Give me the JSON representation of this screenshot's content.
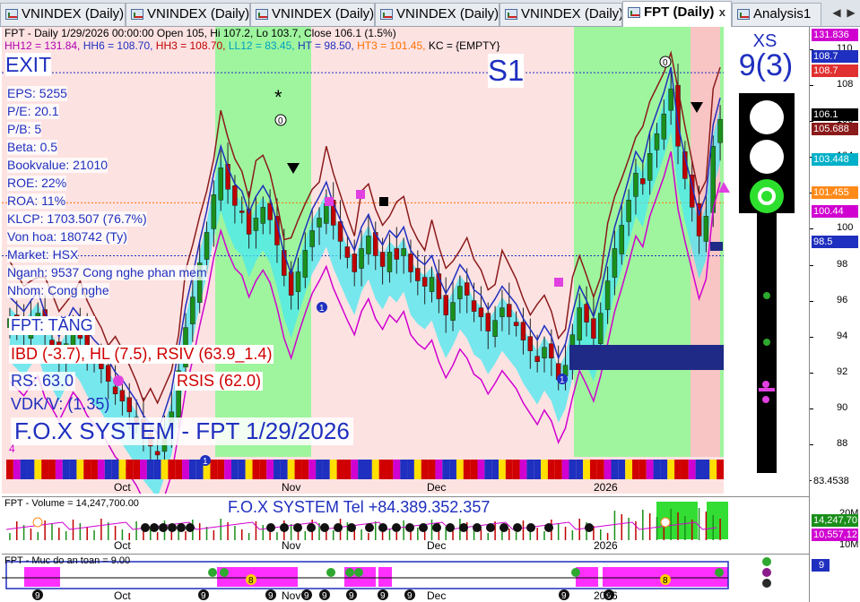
{
  "tabs": [
    {
      "label": "VNINDEX (Daily)",
      "active": false
    },
    {
      "label": "VNINDEX (Daily)",
      "active": false
    },
    {
      "label": "VNINDEX (Daily)",
      "active": false
    },
    {
      "label": "VNINDEX (Daily)",
      "active": false
    },
    {
      "label": "VNINDEX (Daily)",
      "active": false
    },
    {
      "label": "FPT (Daily)",
      "active": true
    },
    {
      "label": "Analysis1",
      "active": false
    }
  ],
  "tab_close": "x",
  "nav": {
    "left": "◀",
    "right": "▶"
  },
  "header": {
    "line1": "FPT - Daily 1/29/2026 00:00:00 Open 105, Hi 107.2, Lo 103.7, Close 106.1 (1.5%)",
    "line2": [
      {
        "text": "HH12 = 131.84, ",
        "color": "#b000b0"
      },
      {
        "text": "HH6 = 108.70, ",
        "color": "#1f2fbf"
      },
      {
        "text": "HH3 = 108.70, ",
        "color": "#c00000"
      },
      {
        "text": "LL12 = 83.45, ",
        "color": "#00a0c0"
      },
      {
        "text": "HT = 98.50, ",
        "color": "#1f2fbf"
      },
      {
        "text": "HT3 = 101.45, ",
        "color": "#ff7000"
      },
      {
        "text": "KC = {EMPTY}",
        "color": "#000"
      }
    ]
  },
  "overlay": {
    "exit": "EXIT",
    "s1": "S1",
    "xs": "XS",
    "xs_count": "9(3)",
    "fundamentals": [
      "EPS: 5255",
      "P/E: 20.1",
      "P/B: 5",
      "Beta: 0.5",
      "Bookvalue: 21010",
      "ROE: 22%",
      "ROA: 11%",
      "KLCP: 1703.507 (76.7%)",
      "Von hoa: 180742 (Ty)",
      "Market: HSX",
      "Nganh: 9537 Cong nghe phan mem",
      "Nhom: Cong nghe"
    ],
    "trend": "FPT: TĂNG",
    "ibd": "IBD (-3.7), HL (7.5), RSIV (63.9_1.4)",
    "rs": "RS: 63.0",
    "rsis": "RSIS (62.0)",
    "vdk": "VDK/V:  (1.35)",
    "system": "F.O.X SYSTEM - FPT 1/29/2026",
    "four": "4",
    "asterisk": "*"
  },
  "volume": {
    "label": "FPT - Volume = 14,247,700.00",
    "tel": "F.O.X SYSTEM Tel +84.389.352.357"
  },
  "safety": {
    "label": "FPT - Muc do an toan = 9.00"
  },
  "x_axis": [
    "Oct",
    "Nov",
    "Dec",
    "2026"
  ],
  "price_axis": {
    "ticks": [
      "110",
      "108",
      "106",
      "104",
      "102",
      "100",
      "98",
      "96",
      "94",
      "92",
      "90",
      "88",
      "86"
    ],
    "tags": [
      {
        "text": "131.836",
        "color": "#d000d0"
      },
      {
        "text": "108.7",
        "color": "#1f2fbf"
      },
      {
        "text": "108.7",
        "color": "#e03030"
      },
      {
        "text": "106.1",
        "color": "#000000"
      },
      {
        "text": "105.688",
        "color": "#8b1a1a"
      },
      {
        "text": "103.448",
        "color": "#00b0c8"
      },
      {
        "text": "101.455",
        "color": "#ff8a1a"
      },
      {
        "text": "100.44",
        "color": "#d000d0"
      },
      {
        "text": "98.5",
        "color": "#1f2fbf"
      },
      {
        "text": "83.4538",
        "color": "#00b0c8"
      }
    ],
    "vol_ticks": [
      "20M",
      "10M"
    ],
    "vol_tags": [
      {
        "text": "14,247,70",
        "color": "#1a8f1a"
      },
      {
        "text": "10,557,12",
        "color": "#d000d0"
      }
    ],
    "safety_tag": "9"
  },
  "markers": {
    "one": "1",
    "zero": "0",
    "eight": "8",
    "nine": "9"
  },
  "chart_data": {
    "type": "candlestick",
    "title": "FPT - Daily 1/29/2026",
    "last": {
      "open": 105,
      "high": 107.2,
      "low": 103.7,
      "close": 106.1,
      "change_pct": 1.5
    },
    "ylim": [
      85,
      111
    ],
    "levels": {
      "HH12": 131.84,
      "HH6": 108.7,
      "HH3": 108.7,
      "LL12": 83.45,
      "HT": 98.5,
      "HT3": 101.45
    },
    "closes": [
      95,
      94.6,
      94.2,
      94.8,
      95.3,
      94.1,
      93.5,
      92.8,
      93.6,
      94.4,
      93.9,
      93.1,
      92.6,
      92.2,
      91.5,
      90.8,
      90.4,
      89.8,
      89.2,
      88.4,
      87.9,
      87.4,
      88.6,
      89.8,
      92.1,
      94.5,
      96.2,
      98.1,
      99.8,
      101.9,
      103.4,
      102.2,
      101.3,
      100.9,
      99.7,
      100.6,
      101.2,
      100.5,
      99.1,
      97.4,
      96.3,
      97.6,
      98.8,
      99.9,
      100.6,
      101.4,
      100.2,
      99.3,
      98.4,
      97.6,
      98.9,
      99.6,
      98.5,
      97.9,
      98.7,
      98.3,
      98.9,
      97.6,
      97.1,
      96.8,
      97.3,
      96.1,
      95.2,
      95.9,
      96.8,
      96.3,
      95.4,
      95.1,
      94.3,
      94.9,
      95.6,
      95.1,
      94.6,
      93.8,
      93.2,
      92.6,
      93.4,
      92.8,
      91.6,
      92.4,
      94.1,
      95.6,
      94.8,
      93.9,
      95.3,
      97.1,
      98.9,
      100.2,
      101.6,
      103.1,
      102.5,
      104.2,
      105.3,
      106.4,
      107.8,
      104.6,
      102.8,
      101.2,
      99.6,
      100.7,
      104.6,
      106.1
    ]
  }
}
